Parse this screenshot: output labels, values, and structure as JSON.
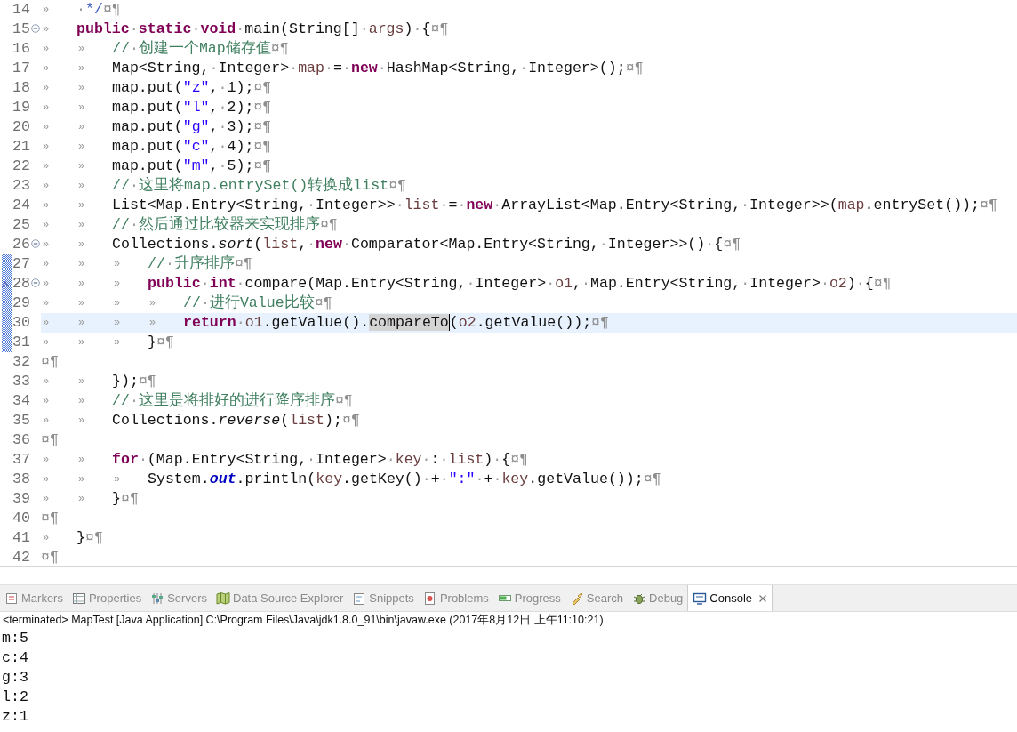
{
  "editor": {
    "lines": [
      {
        "number": "14",
        "fold": false,
        "override": false,
        "changed": false,
        "current": false,
        "tokens": [
          {
            "kind": "tab",
            "text": "»"
          },
          {
            "kind": "sp",
            "text": "·"
          },
          {
            "kind": "doc",
            "text": "*/"
          },
          {
            "kind": "eol",
            "text": "¤¶"
          }
        ]
      },
      {
        "number": "15",
        "fold": true,
        "override": false,
        "changed": false,
        "current": false,
        "tokens": [
          {
            "kind": "tab",
            "text": "»"
          },
          {
            "kind": "kw",
            "text": "public"
          },
          {
            "kind": "sp",
            "text": "·"
          },
          {
            "kind": "kw",
            "text": "static"
          },
          {
            "kind": "sp",
            "text": "·"
          },
          {
            "kind": "kw",
            "text": "void"
          },
          {
            "kind": "sp",
            "text": "·"
          },
          {
            "kind": "plain",
            "text": "main(String[]"
          },
          {
            "kind": "sp",
            "text": "·"
          },
          {
            "kind": "var",
            "text": "args"
          },
          {
            "kind": "plain",
            "text": ")"
          },
          {
            "kind": "sp",
            "text": "·"
          },
          {
            "kind": "plain",
            "text": "{"
          },
          {
            "kind": "eol",
            "text": "¤¶"
          }
        ]
      },
      {
        "number": "16",
        "fold": false,
        "override": false,
        "changed": false,
        "current": false,
        "tokens": [
          {
            "kind": "tab",
            "text": "»"
          },
          {
            "kind": "tab",
            "text": "»"
          },
          {
            "kind": "comment",
            "text": "//"
          },
          {
            "kind": "sp",
            "text": "·"
          },
          {
            "kind": "comment",
            "text": "创建一个Map储存值"
          },
          {
            "kind": "eol",
            "text": "¤¶"
          }
        ]
      },
      {
        "number": "17",
        "fold": false,
        "override": false,
        "changed": false,
        "current": false,
        "tokens": [
          {
            "kind": "tab",
            "text": "»"
          },
          {
            "kind": "tab",
            "text": "»"
          },
          {
            "kind": "plain",
            "text": "Map<String,"
          },
          {
            "kind": "sp",
            "text": "·"
          },
          {
            "kind": "plain",
            "text": "Integer>"
          },
          {
            "kind": "sp",
            "text": "·"
          },
          {
            "kind": "var",
            "text": "map"
          },
          {
            "kind": "sp",
            "text": "·"
          },
          {
            "kind": "plain",
            "text": "="
          },
          {
            "kind": "sp",
            "text": "·"
          },
          {
            "kind": "kw",
            "text": "new"
          },
          {
            "kind": "sp",
            "text": "·"
          },
          {
            "kind": "plain",
            "text": "HashMap<String,"
          },
          {
            "kind": "sp",
            "text": "·"
          },
          {
            "kind": "plain",
            "text": "Integer>();"
          },
          {
            "kind": "eol",
            "text": "¤¶"
          }
        ]
      },
      {
        "number": "18",
        "fold": false,
        "override": false,
        "changed": false,
        "current": false,
        "tokens": [
          {
            "kind": "tab",
            "text": "»"
          },
          {
            "kind": "tab",
            "text": "»"
          },
          {
            "kind": "plain",
            "text": "map.put("
          },
          {
            "kind": "str",
            "text": "\"z\""
          },
          {
            "kind": "plain",
            "text": ","
          },
          {
            "kind": "sp",
            "text": "·"
          },
          {
            "kind": "plain",
            "text": "1);"
          },
          {
            "kind": "eol",
            "text": "¤¶"
          }
        ]
      },
      {
        "number": "19",
        "fold": false,
        "override": false,
        "changed": false,
        "current": false,
        "tokens": [
          {
            "kind": "tab",
            "text": "»"
          },
          {
            "kind": "tab",
            "text": "»"
          },
          {
            "kind": "plain",
            "text": "map.put("
          },
          {
            "kind": "str",
            "text": "\"l\""
          },
          {
            "kind": "plain",
            "text": ","
          },
          {
            "kind": "sp",
            "text": "·"
          },
          {
            "kind": "plain",
            "text": "2);"
          },
          {
            "kind": "eol",
            "text": "¤¶"
          }
        ]
      },
      {
        "number": "20",
        "fold": false,
        "override": false,
        "changed": false,
        "current": false,
        "tokens": [
          {
            "kind": "tab",
            "text": "»"
          },
          {
            "kind": "tab",
            "text": "»"
          },
          {
            "kind": "plain",
            "text": "map.put("
          },
          {
            "kind": "str",
            "text": "\"g\""
          },
          {
            "kind": "plain",
            "text": ","
          },
          {
            "kind": "sp",
            "text": "·"
          },
          {
            "kind": "plain",
            "text": "3);"
          },
          {
            "kind": "eol",
            "text": "¤¶"
          }
        ]
      },
      {
        "number": "21",
        "fold": false,
        "override": false,
        "changed": false,
        "current": false,
        "tokens": [
          {
            "kind": "tab",
            "text": "»"
          },
          {
            "kind": "tab",
            "text": "»"
          },
          {
            "kind": "plain",
            "text": "map.put("
          },
          {
            "kind": "str",
            "text": "\"c\""
          },
          {
            "kind": "plain",
            "text": ","
          },
          {
            "kind": "sp",
            "text": "·"
          },
          {
            "kind": "plain",
            "text": "4);"
          },
          {
            "kind": "eol",
            "text": "¤¶"
          }
        ]
      },
      {
        "number": "22",
        "fold": false,
        "override": false,
        "changed": false,
        "current": false,
        "tokens": [
          {
            "kind": "tab",
            "text": "»"
          },
          {
            "kind": "tab",
            "text": "»"
          },
          {
            "kind": "plain",
            "text": "map.put("
          },
          {
            "kind": "str",
            "text": "\"m\""
          },
          {
            "kind": "plain",
            "text": ","
          },
          {
            "kind": "sp",
            "text": "·"
          },
          {
            "kind": "plain",
            "text": "5);"
          },
          {
            "kind": "eol",
            "text": "¤¶"
          }
        ]
      },
      {
        "number": "23",
        "fold": false,
        "override": false,
        "changed": false,
        "current": false,
        "tokens": [
          {
            "kind": "tab",
            "text": "»"
          },
          {
            "kind": "tab",
            "text": "»"
          },
          {
            "kind": "comment",
            "text": "//"
          },
          {
            "kind": "sp",
            "text": "·"
          },
          {
            "kind": "comment",
            "text": "这里将map.entrySet()转换成list"
          },
          {
            "kind": "eol",
            "text": "¤¶"
          }
        ]
      },
      {
        "number": "24",
        "fold": false,
        "override": false,
        "changed": false,
        "current": false,
        "tokens": [
          {
            "kind": "tab",
            "text": "»"
          },
          {
            "kind": "tab",
            "text": "»"
          },
          {
            "kind": "plain",
            "text": "List<Map.Entry<String,"
          },
          {
            "kind": "sp",
            "text": "·"
          },
          {
            "kind": "plain",
            "text": "Integer>>"
          },
          {
            "kind": "sp",
            "text": "·"
          },
          {
            "kind": "var",
            "text": "list"
          },
          {
            "kind": "sp",
            "text": "·"
          },
          {
            "kind": "plain",
            "text": "="
          },
          {
            "kind": "sp",
            "text": "·"
          },
          {
            "kind": "kw",
            "text": "new"
          },
          {
            "kind": "sp",
            "text": "·"
          },
          {
            "kind": "plain",
            "text": "ArrayList<Map.Entry<String,"
          },
          {
            "kind": "sp",
            "text": "·"
          },
          {
            "kind": "plain",
            "text": "Integer>>("
          },
          {
            "kind": "var",
            "text": "map"
          },
          {
            "kind": "plain",
            "text": ".entrySet());"
          },
          {
            "kind": "eol",
            "text": "¤¶"
          }
        ]
      },
      {
        "number": "25",
        "fold": false,
        "override": false,
        "changed": false,
        "current": false,
        "tokens": [
          {
            "kind": "tab",
            "text": "»"
          },
          {
            "kind": "tab",
            "text": "»"
          },
          {
            "kind": "comment",
            "text": "//"
          },
          {
            "kind": "sp",
            "text": "·"
          },
          {
            "kind": "comment",
            "text": "然后通过比较器来实现排序"
          },
          {
            "kind": "eol",
            "text": "¤¶"
          }
        ]
      },
      {
        "number": "26",
        "fold": true,
        "override": false,
        "changed": false,
        "current": false,
        "tokens": [
          {
            "kind": "tab",
            "text": "»"
          },
          {
            "kind": "tab",
            "text": "»"
          },
          {
            "kind": "plain",
            "text": "Collections."
          },
          {
            "kind": "italic",
            "text": "sort"
          },
          {
            "kind": "plain",
            "text": "("
          },
          {
            "kind": "var",
            "text": "list"
          },
          {
            "kind": "plain",
            "text": ","
          },
          {
            "kind": "sp",
            "text": "·"
          },
          {
            "kind": "kw",
            "text": "new"
          },
          {
            "kind": "sp",
            "text": "·"
          },
          {
            "kind": "plain",
            "text": "Comparator<Map.Entry<String,"
          },
          {
            "kind": "sp",
            "text": "·"
          },
          {
            "kind": "plain",
            "text": "Integer>>()"
          },
          {
            "kind": "sp",
            "text": "·"
          },
          {
            "kind": "plain",
            "text": "{"
          },
          {
            "kind": "eol",
            "text": "¤¶"
          }
        ]
      },
      {
        "number": "27",
        "fold": false,
        "override": false,
        "changed": true,
        "current": false,
        "tokens": [
          {
            "kind": "tab",
            "text": "»"
          },
          {
            "kind": "tab",
            "text": "»"
          },
          {
            "kind": "tab",
            "text": "»"
          },
          {
            "kind": "comment",
            "text": "//"
          },
          {
            "kind": "sp",
            "text": "·"
          },
          {
            "kind": "comment",
            "text": "升序排序"
          },
          {
            "kind": "eol",
            "text": "¤¶"
          }
        ]
      },
      {
        "number": "28",
        "fold": true,
        "override": true,
        "changed": true,
        "current": false,
        "tokens": [
          {
            "kind": "tab",
            "text": "»"
          },
          {
            "kind": "tab",
            "text": "»"
          },
          {
            "kind": "tab",
            "text": "»"
          },
          {
            "kind": "kw",
            "text": "public"
          },
          {
            "kind": "sp",
            "text": "·"
          },
          {
            "kind": "kw",
            "text": "int"
          },
          {
            "kind": "sp",
            "text": "·"
          },
          {
            "kind": "plain",
            "text": "compare(Map.Entry<String,"
          },
          {
            "kind": "sp",
            "text": "·"
          },
          {
            "kind": "plain",
            "text": "Integer>"
          },
          {
            "kind": "sp",
            "text": "·"
          },
          {
            "kind": "var",
            "text": "o1"
          },
          {
            "kind": "plain",
            "text": ","
          },
          {
            "kind": "sp",
            "text": "·"
          },
          {
            "kind": "plain",
            "text": "Map.Entry<String,"
          },
          {
            "kind": "sp",
            "text": "·"
          },
          {
            "kind": "plain",
            "text": "Integer>"
          },
          {
            "kind": "sp",
            "text": "·"
          },
          {
            "kind": "var",
            "text": "o2"
          },
          {
            "kind": "plain",
            "text": ")"
          },
          {
            "kind": "sp",
            "text": "·"
          },
          {
            "kind": "plain",
            "text": "{"
          },
          {
            "kind": "eol",
            "text": "¤¶"
          }
        ]
      },
      {
        "number": "29",
        "fold": false,
        "override": false,
        "changed": true,
        "current": false,
        "tokens": [
          {
            "kind": "tab",
            "text": "»"
          },
          {
            "kind": "tab",
            "text": "»"
          },
          {
            "kind": "tab",
            "text": "»"
          },
          {
            "kind": "tab",
            "text": "»"
          },
          {
            "kind": "comment",
            "text": "//"
          },
          {
            "kind": "sp",
            "text": "·"
          },
          {
            "kind": "comment",
            "text": "进行Value比较"
          },
          {
            "kind": "eol",
            "text": "¤¶"
          }
        ]
      },
      {
        "number": "30",
        "fold": false,
        "override": false,
        "changed": true,
        "current": true,
        "tokens": [
          {
            "kind": "tab",
            "text": "»"
          },
          {
            "kind": "tab",
            "text": "»"
          },
          {
            "kind": "tab",
            "text": "»"
          },
          {
            "kind": "tab",
            "text": "»"
          },
          {
            "kind": "kw",
            "text": "return"
          },
          {
            "kind": "sp",
            "text": "·"
          },
          {
            "kind": "var",
            "text": "o1"
          },
          {
            "kind": "plain",
            "text": ".getValue()."
          },
          {
            "kind": "mark",
            "text": "compareTo"
          },
          {
            "kind": "plain",
            "text": "("
          },
          {
            "kind": "var",
            "text": "o2"
          },
          {
            "kind": "plain",
            "text": ".getValue());"
          },
          {
            "kind": "eol",
            "text": "¤¶"
          }
        ]
      },
      {
        "number": "31",
        "fold": false,
        "override": false,
        "changed": true,
        "current": false,
        "tokens": [
          {
            "kind": "tab",
            "text": "»"
          },
          {
            "kind": "tab",
            "text": "»"
          },
          {
            "kind": "tab",
            "text": "»"
          },
          {
            "kind": "plain",
            "text": "}"
          },
          {
            "kind": "eol",
            "text": "¤¶"
          }
        ]
      },
      {
        "number": "32",
        "fold": false,
        "override": false,
        "changed": false,
        "current": false,
        "tokens": [
          {
            "kind": "eol",
            "text": "¤¶"
          }
        ]
      },
      {
        "number": "33",
        "fold": false,
        "override": false,
        "changed": false,
        "current": false,
        "tokens": [
          {
            "kind": "tab",
            "text": "»"
          },
          {
            "kind": "tab",
            "text": "»"
          },
          {
            "kind": "plain",
            "text": "});"
          },
          {
            "kind": "eol",
            "text": "¤¶"
          }
        ]
      },
      {
        "number": "34",
        "fold": false,
        "override": false,
        "changed": false,
        "current": false,
        "tokens": [
          {
            "kind": "tab",
            "text": "»"
          },
          {
            "kind": "tab",
            "text": "»"
          },
          {
            "kind": "comment",
            "text": "//"
          },
          {
            "kind": "sp",
            "text": "·"
          },
          {
            "kind": "comment",
            "text": "这里是将排好的进行降序排序"
          },
          {
            "kind": "eol",
            "text": "¤¶"
          }
        ]
      },
      {
        "number": "35",
        "fold": false,
        "override": false,
        "changed": false,
        "current": false,
        "tokens": [
          {
            "kind": "tab",
            "text": "»"
          },
          {
            "kind": "tab",
            "text": "»"
          },
          {
            "kind": "plain",
            "text": "Collections."
          },
          {
            "kind": "italic",
            "text": "reverse"
          },
          {
            "kind": "plain",
            "text": "("
          },
          {
            "kind": "var",
            "text": "list"
          },
          {
            "kind": "plain",
            "text": ");"
          },
          {
            "kind": "eol",
            "text": "¤¶"
          }
        ]
      },
      {
        "number": "36",
        "fold": false,
        "override": false,
        "changed": false,
        "current": false,
        "tokens": [
          {
            "kind": "eol",
            "text": "¤¶"
          }
        ]
      },
      {
        "number": "37",
        "fold": false,
        "override": false,
        "changed": false,
        "current": false,
        "tokens": [
          {
            "kind": "tab",
            "text": "»"
          },
          {
            "kind": "tab",
            "text": "»"
          },
          {
            "kind": "kw",
            "text": "for"
          },
          {
            "kind": "sp",
            "text": "·"
          },
          {
            "kind": "plain",
            "text": "(Map.Entry<String,"
          },
          {
            "kind": "sp",
            "text": "·"
          },
          {
            "kind": "plain",
            "text": "Integer>"
          },
          {
            "kind": "sp",
            "text": "·"
          },
          {
            "kind": "var",
            "text": "key"
          },
          {
            "kind": "sp",
            "text": "·"
          },
          {
            "kind": "plain",
            "text": ":"
          },
          {
            "kind": "sp",
            "text": "·"
          },
          {
            "kind": "var",
            "text": "list"
          },
          {
            "kind": "plain",
            "text": ")"
          },
          {
            "kind": "sp",
            "text": "·"
          },
          {
            "kind": "plain",
            "text": "{"
          },
          {
            "kind": "eol",
            "text": "¤¶"
          }
        ]
      },
      {
        "number": "38",
        "fold": false,
        "override": false,
        "changed": false,
        "current": false,
        "tokens": [
          {
            "kind": "tab",
            "text": "»"
          },
          {
            "kind": "tab",
            "text": "»"
          },
          {
            "kind": "tab",
            "text": "»"
          },
          {
            "kind": "plain",
            "text": "System."
          },
          {
            "kind": "field",
            "text": "out"
          },
          {
            "kind": "plain",
            "text": ".println("
          },
          {
            "kind": "var",
            "text": "key"
          },
          {
            "kind": "plain",
            "text": ".getKey()"
          },
          {
            "kind": "sp",
            "text": "·"
          },
          {
            "kind": "plain",
            "text": "+"
          },
          {
            "kind": "sp",
            "text": "·"
          },
          {
            "kind": "str",
            "text": "\":\""
          },
          {
            "kind": "sp",
            "text": "·"
          },
          {
            "kind": "plain",
            "text": "+"
          },
          {
            "kind": "sp",
            "text": "·"
          },
          {
            "kind": "var",
            "text": "key"
          },
          {
            "kind": "plain",
            "text": ".getValue());"
          },
          {
            "kind": "eol",
            "text": "¤¶"
          }
        ]
      },
      {
        "number": "39",
        "fold": false,
        "override": false,
        "changed": false,
        "current": false,
        "tokens": [
          {
            "kind": "tab",
            "text": "»"
          },
          {
            "kind": "tab",
            "text": "»"
          },
          {
            "kind": "plain",
            "text": "}"
          },
          {
            "kind": "eol",
            "text": "¤¶"
          }
        ]
      },
      {
        "number": "40",
        "fold": false,
        "override": false,
        "changed": false,
        "current": false,
        "tokens": [
          {
            "kind": "eol",
            "text": "¤¶"
          }
        ]
      },
      {
        "number": "41",
        "fold": false,
        "override": false,
        "changed": false,
        "current": false,
        "tokens": [
          {
            "kind": "tab",
            "text": "»"
          },
          {
            "kind": "plain",
            "text": "}"
          },
          {
            "kind": "eol",
            "text": "¤¶"
          }
        ]
      },
      {
        "number": "42",
        "fold": false,
        "override": false,
        "changed": false,
        "current": false,
        "tokens": [
          {
            "kind": "eol",
            "text": "¤¶"
          }
        ]
      }
    ]
  },
  "panel_tabs": [
    {
      "label": "Markers",
      "selected": false,
      "closable": false
    },
    {
      "label": "Properties",
      "selected": false,
      "closable": false
    },
    {
      "label": "Servers",
      "selected": false,
      "closable": false
    },
    {
      "label": "Data Source Explorer",
      "selected": false,
      "closable": false
    },
    {
      "label": "Snippets",
      "selected": false,
      "closable": false
    },
    {
      "label": "Problems",
      "selected": false,
      "closable": false
    },
    {
      "label": "Progress",
      "selected": false,
      "closable": false
    },
    {
      "label": "Search",
      "selected": false,
      "closable": false
    },
    {
      "label": "Debug",
      "selected": false,
      "closable": false
    },
    {
      "label": "Console",
      "selected": true,
      "closable": true
    }
  ],
  "console": {
    "header": "<terminated> MapTest [Java Application] C:\\Program Files\\Java\\jdk1.8.0_91\\bin\\javaw.exe (2017年8月12日 上午11:10:21)",
    "output": [
      "m:5",
      "c:4",
      "g:3",
      "l:2",
      "z:1"
    ]
  }
}
